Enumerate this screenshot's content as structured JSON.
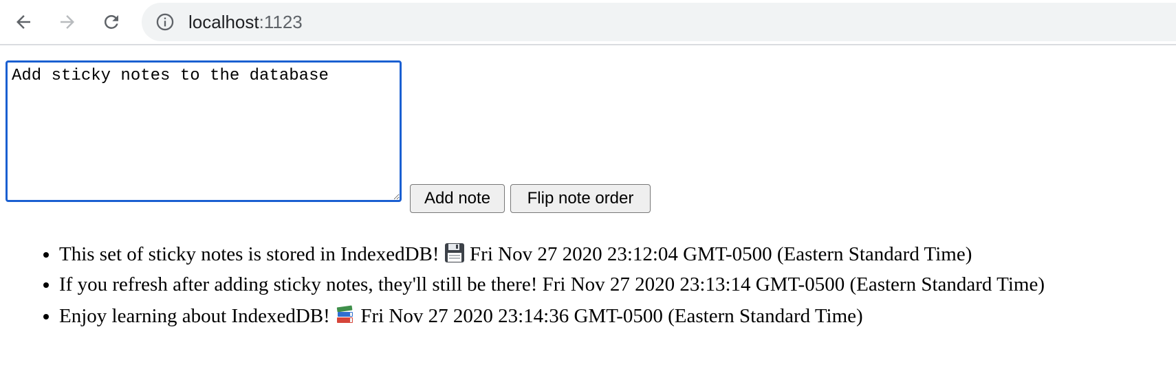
{
  "browser": {
    "url_host": "localhost",
    "url_port": ":1123",
    "back_icon": "arrow-left",
    "forward_icon": "arrow-right",
    "reload_icon": "reload",
    "info_icon": "info-circle"
  },
  "form": {
    "textarea_value": "Add sticky notes to the database",
    "add_button_label": "Add note",
    "flip_button_label": "Flip note order"
  },
  "notes": [
    {
      "text": "This set of sticky notes is stored in IndexedDB!",
      "emoji": "floppy-disk",
      "timestamp": "Fri Nov 27 2020 23:12:04 GMT-0500 (Eastern Standard Time)"
    },
    {
      "text": "If you refresh after adding sticky notes, they'll still be there!",
      "emoji": "",
      "timestamp": "Fri Nov 27 2020 23:13:14 GMT-0500 (Eastern Standard Time)"
    },
    {
      "text": "Enjoy learning about IndexedDB!",
      "emoji": "books",
      "timestamp": "Fri Nov 27 2020 23:14:36 GMT-0500 (Eastern Standard Time)"
    }
  ],
  "colors": {
    "focus_ring": "#1a5fd1",
    "omnibox_bg": "#f1f3f4",
    "button_bg": "#efefef"
  }
}
